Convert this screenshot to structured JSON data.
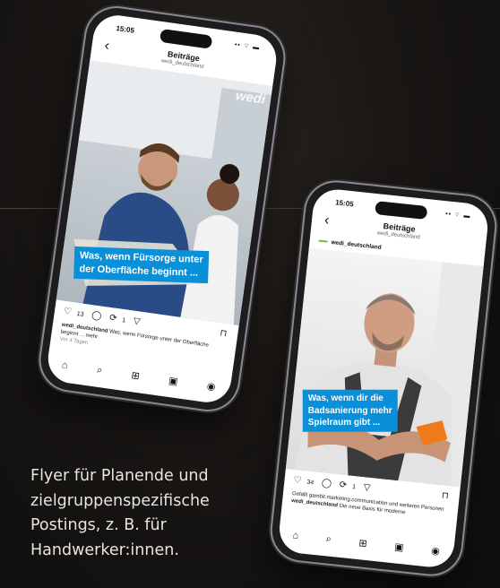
{
  "caption": {
    "lines": [
      "Flyer für Planende und",
      "zielgruppenspezifische",
      "Postings, z. B. für",
      "Handwerker:innen."
    ]
  },
  "phone_left": {
    "time": "15:05",
    "status_icons": "▪▪ ⌔ ▬",
    "back_icon": "‹",
    "header_title": "Beiträge",
    "header_sub": "wedi_deutschland",
    "brand_watermark": "wedi",
    "banner": [
      "Was, wenn Fürsorge unter",
      "der Oberfläche beginnt ..."
    ],
    "like_count": "13",
    "repost_count": "1",
    "caption_user": "wedi_deutschland",
    "caption_text": "Was, wenn Fürsorge unter der Oberfläche beginnt ... mehr",
    "timestamp": "Vor 4 Tagen",
    "nav_icons": [
      "⌂",
      "⌕",
      "⊞",
      "▣",
      "◉"
    ]
  },
  "phone_right": {
    "time": "15:05",
    "status_icons": "▪▪ ⌔ ▬",
    "back_icon": "‹",
    "header_title": "Beiträge",
    "header_sub": "wedi_deutschland",
    "post_user": "wedi_deutschland",
    "banner": [
      "Was, wenn dir die",
      "Badsanierung mehr",
      "Spielraum gibt ..."
    ],
    "like_count": "34",
    "repost_count": "1",
    "liked_by": "Gefällt gambit.marketing.communication und weiteren Personen",
    "caption_user": "wedi_deutschland",
    "caption_text": "Die neue Basis für moderne",
    "nav_icons": [
      "⌂",
      "⌕",
      "⊞",
      "▣",
      "◉"
    ]
  },
  "colors": {
    "banner_blue": "#0a90d8",
    "accent_green": "#6dbb4a"
  }
}
